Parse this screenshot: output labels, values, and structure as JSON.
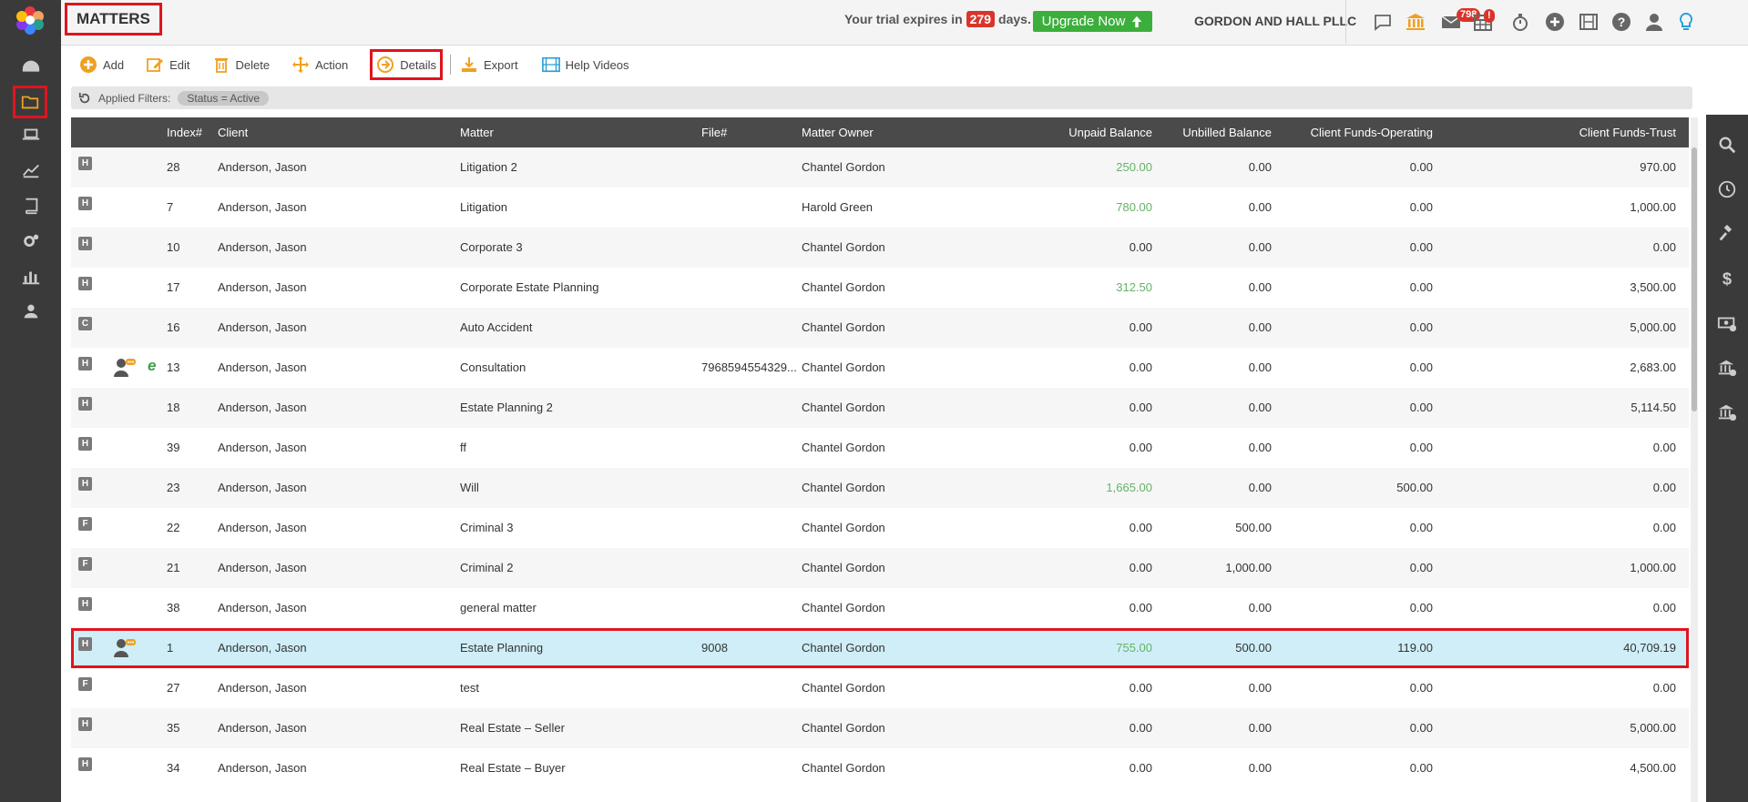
{
  "page_title": "MATTERS",
  "trial": {
    "prefix": "Your trial expires in",
    "days": "279",
    "suffix": "days."
  },
  "upgrade_label": "Upgrade Now",
  "firm_name": "GORDON AND HALL PLLC",
  "badges": {
    "mail_count": "798",
    "calendar_alert": "!"
  },
  "toolbar": {
    "add": "Add",
    "edit": "Edit",
    "delete": "Delete",
    "action": "Action",
    "details": "Details",
    "export": "Export",
    "help_videos": "Help Videos"
  },
  "filters": {
    "label": "Applied Filters:",
    "chip": "Status = Active"
  },
  "columns": {
    "index": "Index#",
    "client": "Client",
    "matter": "Matter",
    "file": "File#",
    "owner": "Matter Owner",
    "unpaid": "Unpaid Balance",
    "unbilled": "Unbilled Balance",
    "operating": "Client Funds-Operating",
    "trust": "Client Funds-Trust"
  },
  "rows": [
    {
      "type": "H",
      "index": "28",
      "client": "Anderson, Jason",
      "matter": "Litigation 2",
      "file": "",
      "owner": "Chantel Gordon",
      "unpaid": "250.00",
      "unbilled": "0.00",
      "operating": "0.00",
      "trust": "970.00",
      "unpaid_green": true
    },
    {
      "type": "H",
      "index": "7",
      "client": "Anderson, Jason",
      "matter": "Litigation",
      "file": "",
      "owner": "Harold Green",
      "unpaid": "780.00",
      "unbilled": "0.00",
      "operating": "0.00",
      "trust": "1,000.00",
      "unpaid_green": true
    },
    {
      "type": "H",
      "index": "10",
      "client": "Anderson, Jason",
      "matter": "Corporate 3",
      "file": "",
      "owner": "Chantel Gordon",
      "unpaid": "0.00",
      "unbilled": "0.00",
      "operating": "0.00",
      "trust": "0.00"
    },
    {
      "type": "H",
      "index": "17",
      "client": "Anderson, Jason",
      "matter": "Corporate Estate Planning",
      "file": "",
      "owner": "Chantel Gordon",
      "unpaid": "312.50",
      "unbilled": "0.00",
      "operating": "0.00",
      "trust": "3,500.00",
      "unpaid_green": true
    },
    {
      "type": "C",
      "index": "16",
      "client": "Anderson, Jason",
      "matter": "Auto Accident",
      "file": "",
      "owner": "Chantel Gordon",
      "unpaid": "0.00",
      "unbilled": "0.00",
      "operating": "0.00",
      "trust": "5,000.00"
    },
    {
      "type": "H",
      "index": "13",
      "client": "Anderson, Jason",
      "matter": "Consultation",
      "file": "7968594554329...",
      "owner": "Chantel Gordon",
      "unpaid": "0.00",
      "unbilled": "0.00",
      "operating": "0.00",
      "trust": "2,683.00",
      "person": true,
      "e": true
    },
    {
      "type": "H",
      "index": "18",
      "client": "Anderson, Jason",
      "matter": "Estate Planning 2",
      "file": "",
      "owner": "Chantel Gordon",
      "unpaid": "0.00",
      "unbilled": "0.00",
      "operating": "0.00",
      "trust": "5,114.50"
    },
    {
      "type": "H",
      "index": "39",
      "client": "Anderson, Jason",
      "matter": "ff",
      "file": "",
      "owner": "Chantel Gordon",
      "unpaid": "0.00",
      "unbilled": "0.00",
      "operating": "0.00",
      "trust": "0.00"
    },
    {
      "type": "H",
      "index": "23",
      "client": "Anderson, Jason",
      "matter": "Will",
      "file": "",
      "owner": "Chantel Gordon",
      "unpaid": "1,665.00",
      "unbilled": "0.00",
      "operating": "500.00",
      "trust": "0.00",
      "unpaid_green": true
    },
    {
      "type": "F",
      "index": "22",
      "client": "Anderson, Jason",
      "matter": "Criminal 3",
      "file": "",
      "owner": "Chantel Gordon",
      "unpaid": "0.00",
      "unbilled": "500.00",
      "operating": "0.00",
      "trust": "0.00"
    },
    {
      "type": "F",
      "index": "21",
      "client": "Anderson, Jason",
      "matter": "Criminal 2",
      "file": "",
      "owner": "Chantel Gordon",
      "unpaid": "0.00",
      "unbilled": "1,000.00",
      "operating": "0.00",
      "trust": "1,000.00"
    },
    {
      "type": "H",
      "index": "38",
      "client": "Anderson, Jason",
      "matter": "general matter",
      "file": "",
      "owner": "Chantel Gordon",
      "unpaid": "0.00",
      "unbilled": "0.00",
      "operating": "0.00",
      "trust": "0.00"
    },
    {
      "type": "H",
      "index": "1",
      "client": "Anderson, Jason",
      "matter": "Estate Planning",
      "file": "9008",
      "owner": "Chantel Gordon",
      "unpaid": "755.00",
      "unbilled": "500.00",
      "operating": "119.00",
      "trust": "40,709.19",
      "unpaid_green": true,
      "person": true,
      "selected": true
    },
    {
      "type": "F",
      "index": "27",
      "client": "Anderson, Jason",
      "matter": "test",
      "file": "",
      "owner": "Chantel Gordon",
      "unpaid": "0.00",
      "unbilled": "0.00",
      "operating": "0.00",
      "trust": "0.00"
    },
    {
      "type": "H",
      "index": "35",
      "client": "Anderson, Jason",
      "matter": "Real Estate – Seller",
      "file": "",
      "owner": "Chantel Gordon",
      "unpaid": "0.00",
      "unbilled": "0.00",
      "operating": "0.00",
      "trust": "5,000.00"
    },
    {
      "type": "H",
      "index": "34",
      "client": "Anderson, Jason",
      "matter": "Real Estate – Buyer",
      "file": "",
      "owner": "Chantel Gordon",
      "unpaid": "0.00",
      "unbilled": "0.00",
      "operating": "0.00",
      "trust": "4,500.00"
    }
  ],
  "colors": {
    "accent": "#e0141e",
    "sidebar": "#3a3a3a",
    "upgrade": "#3cae3c",
    "icon_orange": "#f0a020",
    "icon_blue": "#2a9fd6",
    "selected_row": "#cfeef7",
    "green_amount": "#66b366"
  }
}
